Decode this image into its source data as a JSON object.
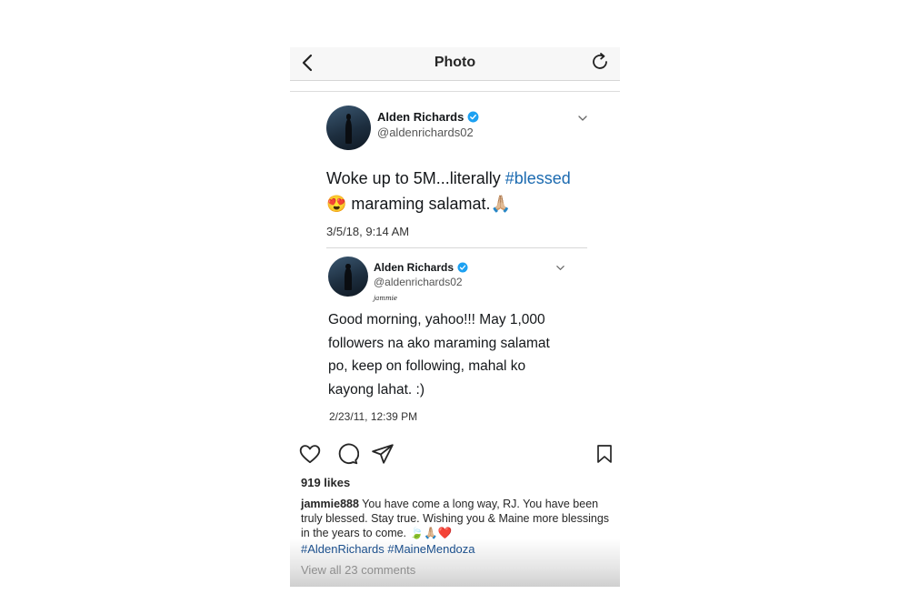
{
  "topbar": {
    "title": "Photo",
    "back_icon": "chevron-left-icon",
    "refresh_icon": "refresh-icon"
  },
  "main_tweet": {
    "name": "Alden Richards",
    "handle": "@aldenrichards02",
    "text_before": "Woke up to 5M...literally ",
    "hashtag": "#blessed",
    "line2": "😍 maraming salamat.🙏🏼",
    "date": "3/5/18, 9:14 AM"
  },
  "quoted_tweet": {
    "name": "Alden Richards",
    "handle": "@aldenrichards02",
    "signature": "jammie",
    "lines": [
      "Good morning, yahoo!!! May 1,000",
      "followers na ako maraming salamat",
      "po, keep on following, mahal ko",
      "kayong lahat. :)"
    ],
    "date": "2/23/11, 12:39 PM"
  },
  "post": {
    "likes": "919 likes",
    "caption_user": "jammie888",
    "caption_text": " You have come a long way, RJ. You have been truly blessed. Stay true. Wishing you & Maine more blessings in the years to come. 🍃🙏🏼❤️",
    "hashtags": "#AldenRichards #MaineMendoza",
    "view_all": "View all 23 comments"
  },
  "colors": {
    "hashtag": "#1b6ab0",
    "verified": "#1da1f2"
  }
}
